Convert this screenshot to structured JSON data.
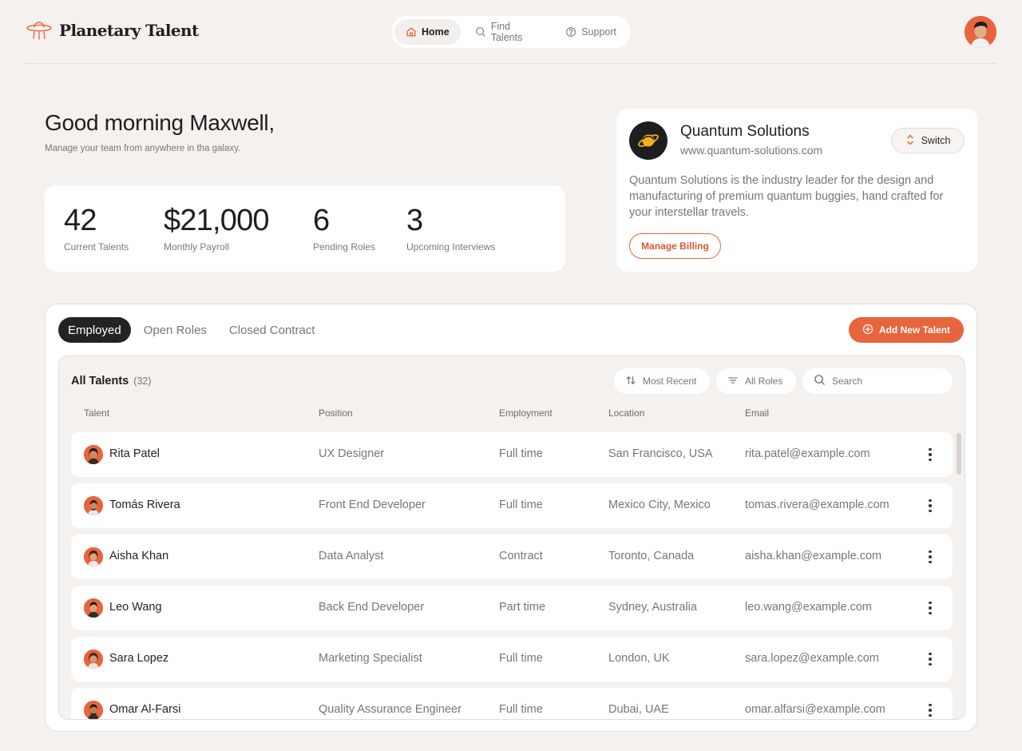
{
  "header": {
    "brand": "Planetary Talent",
    "nav": [
      {
        "label": "Home",
        "icon": "home-icon",
        "active": true
      },
      {
        "label": "Find Talents",
        "icon": "search-icon",
        "active": false
      },
      {
        "label": "Support",
        "icon": "help-circle-icon",
        "active": false
      }
    ]
  },
  "greeting": {
    "title": "Good morning Maxwell,",
    "subtitle": "Manage your team from anywhere in tha galaxy."
  },
  "stats": [
    {
      "value": "42",
      "label": "Current Talents"
    },
    {
      "value": "$21,000",
      "label": "Monthly Payroll"
    },
    {
      "value": "6",
      "label": "Pending Roles"
    },
    {
      "value": "3",
      "label": "Upcoming Interviews"
    }
  ],
  "company": {
    "name": "Quantum Solutions",
    "url": "www.quantum-solutions.com",
    "switch_label": "Switch",
    "description": "Quantum Solutions is the industry leader for the design and manufacturing of premium quantum buggies, hand crafted for your interstellar travels.",
    "billing_label": "Manage Billing"
  },
  "talents": {
    "tabs": [
      {
        "label": "Employed",
        "active": true
      },
      {
        "label": "Open Roles",
        "active": false
      },
      {
        "label": "Closed Contract",
        "active": false
      }
    ],
    "add_label": "Add New Talent",
    "title": "All Talents",
    "count": "(32)",
    "sort_label": "Most Recent",
    "filter_label": "All Roles",
    "search_placeholder": "Search",
    "columns": [
      "Talent",
      "Position",
      "Employment",
      "Location",
      "Email"
    ],
    "rows": [
      {
        "name": "Rita Patel",
        "position": "UX Designer",
        "employment": "Full time",
        "location": "San Francisco, USA",
        "email": "rita.patel@example.com"
      },
      {
        "name": "Tomás Rivera",
        "position": "Front End Developer",
        "employment": "Full time",
        "location": "Mexico City, Mexico",
        "email": "tomas.rivera@example.com"
      },
      {
        "name": "Aisha Khan",
        "position": "Data Analyst",
        "employment": "Contract",
        "location": "Toronto, Canada",
        "email": "aisha.khan@example.com"
      },
      {
        "name": "Leo Wang",
        "position": "Back End Developer",
        "employment": "Part time",
        "location": "Sydney, Australia",
        "email": "leo.wang@example.com"
      },
      {
        "name": "Sara Lopez",
        "position": "Marketing Specialist",
        "employment": "Full time",
        "location": "London, UK",
        "email": "sara.lopez@example.com"
      },
      {
        "name": "Omar Al-Farsi",
        "position": "Quality Assurance Engineer",
        "employment": "Full time",
        "location": "Dubai, UAE",
        "email": "omar.alfarsi@example.com"
      }
    ]
  },
  "colors": {
    "accent": "#e8643c",
    "background": "#f5f1ef",
    "dark": "#232323"
  }
}
